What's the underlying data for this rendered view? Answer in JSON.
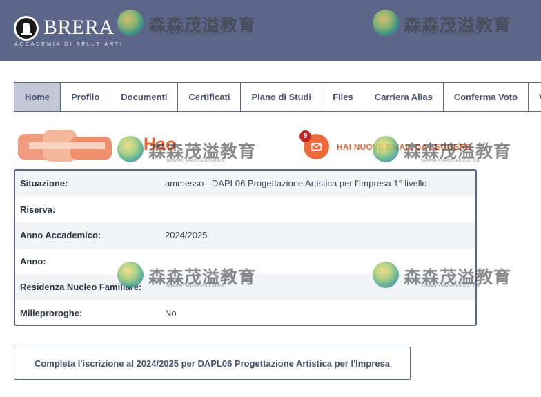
{
  "header": {
    "title": "BRERA",
    "subtitle": "ACCADEMIA DI BELLE ARTI"
  },
  "nav": {
    "items": [
      {
        "label": "Home",
        "active": true
      },
      {
        "label": "Profilo"
      },
      {
        "label": "Documenti"
      },
      {
        "label": "Certificati"
      },
      {
        "label": "Piano di Studi"
      },
      {
        "label": "Files"
      },
      {
        "label": "Carriera Alias"
      },
      {
        "label": "Conferma Voto"
      },
      {
        "label": "V"
      }
    ]
  },
  "notification": {
    "brand_fragment": "Hao",
    "badge_count": "9",
    "text": "HAI NUOVE EMAIL DA LEGGERE"
  },
  "info": {
    "rows": [
      {
        "label": "Situazione:",
        "value": "ammesso - DAPL06 Progettazione Artistica per l'Impresa 1° livello"
      },
      {
        "label": "Riserva:",
        "value": ""
      },
      {
        "label": "Anno Accademico:",
        "value": "2024/2025"
      },
      {
        "label": "Anno:",
        "value": ""
      },
      {
        "label": "Residenza Nucleo Familiare:",
        "value": ""
      },
      {
        "label": "Milleproroghe:",
        "value": "No"
      }
    ]
  },
  "cta": {
    "label": "Completa l'iscrizione al 2024/2025 per DAPL06 Progettazione Artistica per l'Impresa"
  },
  "watermark": {
    "chinese": "森森茂溢教育",
    "registered": "®",
    "english": "SENMIAO MAOYI EDUCATION"
  },
  "colors": {
    "header_bg": "#5b6688",
    "accent_orange": "#ea6a3c",
    "badge_red": "#c62626",
    "border": "#5b6688"
  }
}
